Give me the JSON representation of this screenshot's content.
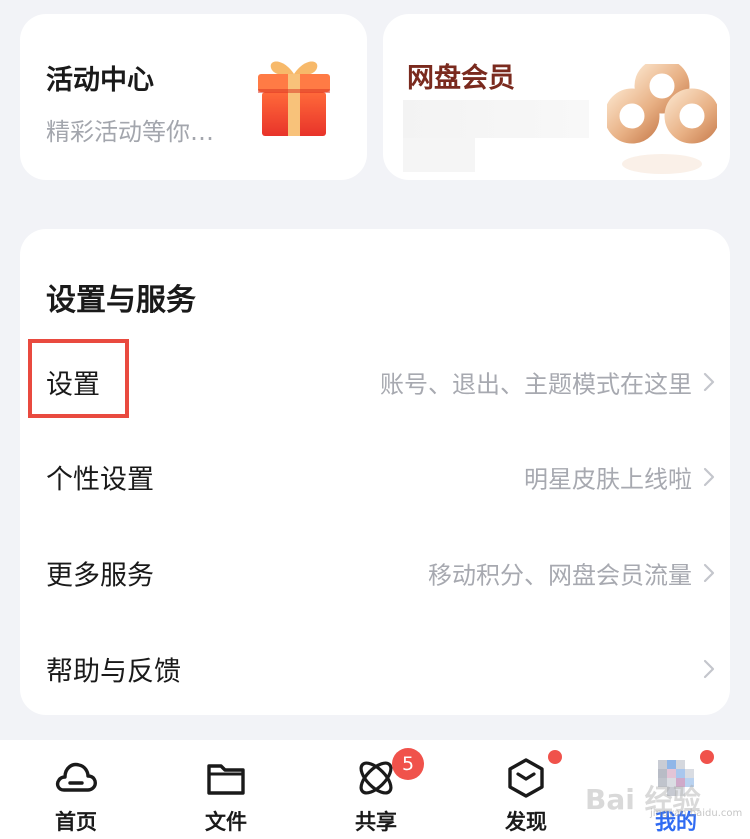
{
  "activity_card": {
    "title": "活动中心",
    "subtitle": "精彩活动等你…"
  },
  "vip_card": {
    "title": "网盘会员"
  },
  "settings_panel": {
    "title": "设置与服务",
    "rows": [
      {
        "label": "设置",
        "desc": "账号、退出、主题模式在这里"
      },
      {
        "label": "个性设置",
        "desc": "明星皮肤上线啦"
      },
      {
        "label": "更多服务",
        "desc": "移动积分、网盘会员流量"
      },
      {
        "label": "帮助与反馈",
        "desc": ""
      }
    ]
  },
  "tabbar": {
    "tabs": [
      {
        "label": "首页",
        "icon": "cloud-home-icon"
      },
      {
        "label": "文件",
        "icon": "folder-icon"
      },
      {
        "label": "共享",
        "icon": "share-orbit-icon",
        "badge": "5"
      },
      {
        "label": "发现",
        "icon": "discover-box-icon"
      },
      {
        "label": "我的",
        "icon": "avatar-icon",
        "active": true
      }
    ]
  },
  "watermark": {
    "text": "Bai 经验",
    "url": "jingyan.baidu.com"
  },
  "colors": {
    "accent": "#2f6bf3",
    "badge": "#f0524b",
    "highlight": "#e94a3f",
    "vip_title": "#7a2a1e"
  }
}
